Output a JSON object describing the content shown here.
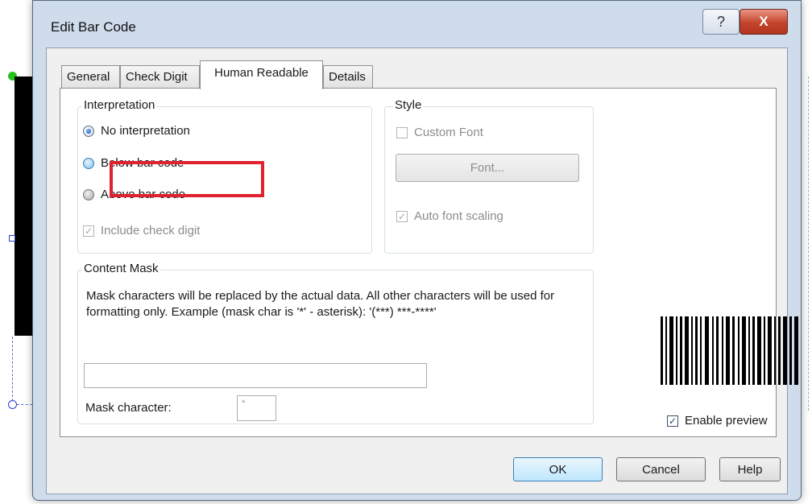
{
  "window": {
    "title": "Edit Bar Code",
    "help_glyph": "?",
    "close_glyph": "X"
  },
  "tabs": [
    {
      "label": "General",
      "active": false
    },
    {
      "label": "Check Digit",
      "active": false
    },
    {
      "label": "Human Readable",
      "active": true
    },
    {
      "label": "Details",
      "active": false
    }
  ],
  "interpretation": {
    "label": "Interpretation",
    "options": [
      {
        "label": "No interpretation",
        "selected": true
      },
      {
        "label": "Below bar code",
        "selected": false
      },
      {
        "label": "Above bar code",
        "selected": false
      }
    ],
    "include_check_digit": {
      "label": "Include check digit",
      "checked": true,
      "enabled": false
    }
  },
  "style": {
    "label": "Style",
    "custom_font": {
      "label": "Custom Font",
      "checked": false,
      "enabled": false
    },
    "font_button": "Font...",
    "auto_font_scaling": {
      "label": "Auto font scaling",
      "checked": true,
      "enabled": false
    }
  },
  "content_mask": {
    "label": "Content Mask",
    "description": "Mask characters will be replaced by the actual data. All other characters will be used for formatting only. Example (mask char is '*' - asterisk): '(***) ***-****'",
    "mask_value": "",
    "mask_character_label": "Mask character:",
    "mask_character_value": "*"
  },
  "preview": {
    "enable_label": "Enable preview",
    "checked": true
  },
  "buttons": {
    "ok": "OK",
    "cancel": "Cancel",
    "help": "Help"
  },
  "colors": {
    "highlight": "#e0212f",
    "checkmark": "#1e3d7a"
  }
}
